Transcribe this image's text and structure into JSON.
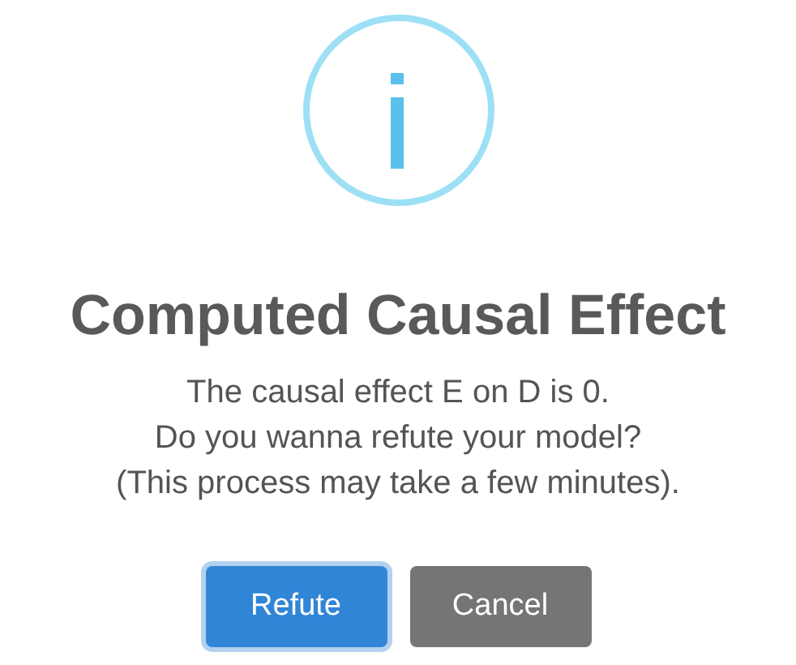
{
  "dialog": {
    "icon": {
      "kind": "info"
    },
    "title": "Computed Causal Effect",
    "message": [
      "The causal effect E on D is 0.",
      "Do you wanna refute your model?",
      "(This process may take a few minutes)."
    ],
    "buttons": [
      {
        "label": "Refute",
        "kind": "confirm",
        "focused": true
      },
      {
        "label": "Cancel",
        "kind": "cancel",
        "focused": false
      }
    ]
  }
}
